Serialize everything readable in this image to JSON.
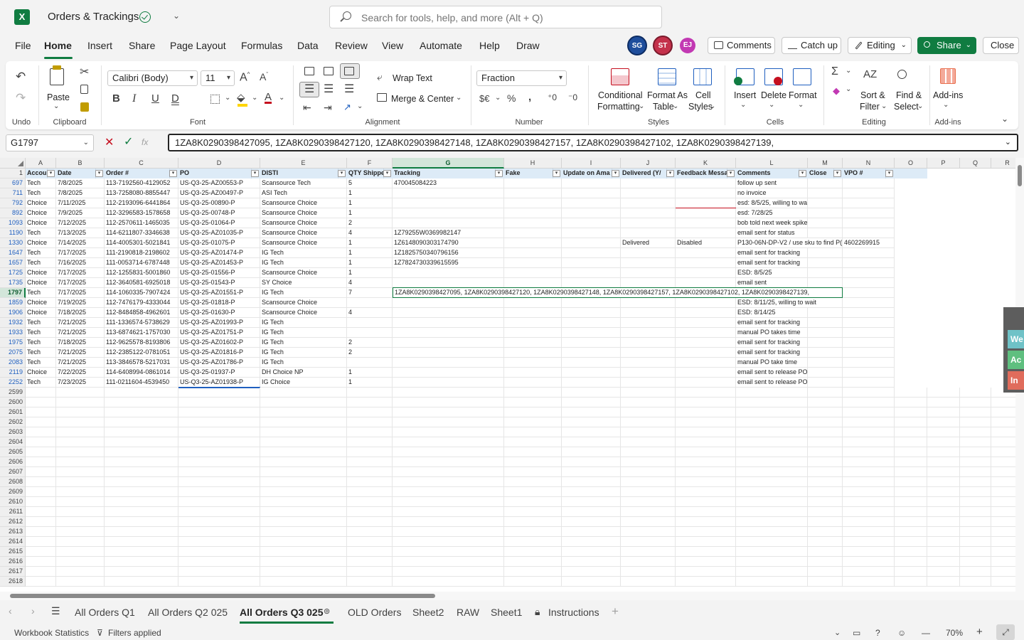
{
  "app": {
    "title": "Orders & Trackings",
    "search_placeholder": "Search for tools, help, and more (Alt + Q)"
  },
  "menu": [
    "File",
    "Home",
    "Insert",
    "Share",
    "Page Layout",
    "Formulas",
    "Data",
    "Review",
    "View",
    "Automate",
    "Help",
    "Draw"
  ],
  "header_actions": {
    "avatars": [
      {
        "initials": "SG",
        "color": "#1f4e9c"
      },
      {
        "initials": "ST",
        "color": "#c4314b"
      },
      {
        "initials": "EJ",
        "color": "#c239b3"
      }
    ],
    "comments": "Comments",
    "catch_up": "Catch up",
    "editing": "Editing",
    "share": "Share",
    "close": "Close"
  },
  "ribbon": {
    "undo_label": "Undo",
    "paste": "Paste",
    "clipboard_label": "Clipboard",
    "font_name": "Calibri (Body)",
    "font_size": "11",
    "font_label": "Font",
    "wrap_text": "Wrap Text",
    "merge_center": "Merge & Center",
    "alignment_label": "Alignment",
    "number_format": "Fraction",
    "number_label": "Number",
    "conditional_formatting_1": "Conditional",
    "conditional_formatting_2": "Formatting",
    "format_as_table_1": "Format As",
    "format_as_table_2": "Table",
    "cell_styles_1": "Cell",
    "cell_styles_2": "Styles",
    "styles_label": "Styles",
    "insert": "Insert",
    "delete": "Delete",
    "format": "Format",
    "cells_label": "Cells",
    "sort_filter_1": "Sort &",
    "sort_filter_2": "Filter",
    "find_select_1": "Find &",
    "find_select_2": "Select",
    "editing_label": "Editing",
    "addins": "Add-ins",
    "addins_label": "Add-ins"
  },
  "formula_bar": {
    "name_box": "G1797",
    "fx": "fx",
    "content": "1ZA8K0290398427095, 1ZA8K0290398427120, 1ZA8K0290398427148, 1ZA8K0290398427157, 1ZA8K0290398427102, 1ZA8K0290398427139,"
  },
  "grid": {
    "column_letters": [
      "A",
      "B",
      "C",
      "D",
      "E",
      "F",
      "G",
      "H",
      "I",
      "J",
      "K",
      "L",
      "M",
      "N",
      "O",
      "P",
      "Q",
      "R"
    ],
    "headers": [
      "Accou",
      "Date",
      "Order #",
      "PO",
      "DISTI",
      "QTY Shippe",
      "Tracking",
      "Fake",
      "Update on Ama",
      "Delivered (Y/",
      "Feedback Messa",
      "Comments",
      "Close",
      "VPO #"
    ],
    "rows": [
      {
        "n": "697",
        "cells": [
          "Tech",
          "7/8/2025",
          "113-7192560-4129052",
          "US-Q3-25-AZ00553-P",
          "Scansource Tech",
          "5",
          "470045084223",
          "",
          "",
          "",
          "",
          "follow up sent",
          "",
          ""
        ]
      },
      {
        "n": "711",
        "cells": [
          "Tech",
          "7/8/2025",
          "113-7258080-8855447",
          "US-Q3-25-AZ00497-P",
          "ASI Tech",
          "1",
          "",
          "",
          "",
          "",
          "",
          "no invoice",
          "",
          ""
        ]
      },
      {
        "n": "792",
        "cells": [
          "Choice",
          "7/11/2025",
          "112-2193096-6441864",
          "US-Q3-25-00890-P",
          "Scansource Choice",
          "1",
          "",
          "",
          "",
          "",
          "",
          "esd: 8/5/25, willing to wait",
          "",
          ""
        ]
      },
      {
        "n": "892",
        "cells": [
          "Choice",
          "7/9/2025",
          "112-3296583-1578658",
          "US-Q3-25-00748-P",
          "Scansource Choice",
          "1",
          "",
          "",
          "",
          "",
          "",
          "esd: 7/28/25",
          "",
          ""
        ]
      },
      {
        "n": "1093",
        "cells": [
          "Choice",
          "7/12/2025",
          "112-2570611-1465035",
          "US-Q3-25-01064-P",
          "Scansource Choice",
          "2",
          "",
          "",
          "",
          "",
          "",
          "bob told next week spike",
          "",
          ""
        ]
      },
      {
        "n": "1190",
        "cells": [
          "Tech",
          "7/13/2025",
          "114-6211807-3346638",
          "US-Q3-25-AZ01035-P",
          "Scansource Choice",
          "4",
          "1Z79255W0369982147",
          "",
          "",
          "",
          "",
          "email sent for status",
          "",
          ""
        ]
      },
      {
        "n": "1330",
        "cells": [
          "Choice",
          "7/14/2025",
          "114-4005301-5021841",
          "US-Q3-25-01075-P",
          "Scansource Choice",
          "1",
          "1Z6148090303174790",
          "",
          "",
          "Delivered",
          "Disabled",
          "P130-06N-DP-V2 / use sku to find P(",
          "",
          "4602269915"
        ]
      },
      {
        "n": "1647",
        "cells": [
          "Tech",
          "7/17/2025",
          "111-2190818-2198602",
          "US-Q3-25-AZ01474-P",
          "IG Tech",
          "1",
          "1Z1825750340796156",
          "",
          "",
          "",
          "",
          "email sent for tracking",
          "",
          ""
        ]
      },
      {
        "n": "1657",
        "cells": [
          "Tech",
          "7/16/2025",
          "111-0053714-6787448",
          "US-Q3-25-AZ01453-P",
          "IG Tech",
          "1",
          "1Z7824730339615595",
          "",
          "",
          "",
          "",
          "email sent for tracking",
          "",
          ""
        ]
      },
      {
        "n": "1725",
        "cells": [
          "Choice",
          "7/17/2025",
          "112-1255831-5001860",
          "US-Q3-25-01556-P",
          "Scansource Choice",
          "1",
          "",
          "",
          "",
          "",
          "",
          " ESD:  8/5/25",
          "",
          ""
        ]
      },
      {
        "n": "1735",
        "cells": [
          "Choice",
          "7/17/2025",
          "112-3640581-6925018",
          "US-Q3-25-01543-P",
          "SY Choice",
          "4",
          "",
          "",
          "",
          "",
          "",
          "email sent",
          "",
          ""
        ]
      },
      {
        "n": "1797",
        "cells": [
          "Tech",
          "7/17/2025",
          "114-1060335-7907424",
          "US-Q3-25-AZ01551-P",
          "IG Tech",
          "7",
          "1ZA8K0290398427095, 1ZA8K0290398427120, 1ZA8K0290398427148, 1ZA8K0290398427157, 1ZA8K0290398427102, 1ZA8K0290398427139,",
          "",
          "",
          "",
          "",
          "",
          "",
          ""
        ]
      },
      {
        "n": "1859",
        "cells": [
          "Choice",
          "7/19/2025",
          "112-7476179-4333044",
          "US-Q3-25-01818-P",
          "Scansource Choice",
          "",
          "",
          "",
          "",
          "",
          "",
          "ESD: 8/11/25, willing to wait",
          "",
          ""
        ]
      },
      {
        "n": "1906",
        "cells": [
          "Choice",
          "7/18/2025",
          "112-8484858-4962601",
          "US-Q3-25-01630-P",
          "Scansource Choice",
          "4",
          "",
          "",
          "",
          "",
          "",
          "ESD: 8/14/25",
          "",
          ""
        ]
      },
      {
        "n": "1932",
        "cells": [
          "Tech",
          "7/21/2025",
          "111-1336574-5738629",
          "US-Q3-25-AZ01993-P",
          "IG Tech",
          "",
          "",
          "",
          "",
          "",
          "",
          "email sent for tracking",
          "",
          ""
        ]
      },
      {
        "n": "1933",
        "cells": [
          "Tech",
          "7/21/2025",
          "113-6874621-1757030",
          "US-Q3-25-AZ01751-P",
          "IG Tech",
          "",
          "",
          "",
          "",
          "",
          "",
          "manual PO takes time",
          "",
          ""
        ]
      },
      {
        "n": "1975",
        "cells": [
          "Tech",
          "7/18/2025",
          "112-9625578-8193806",
          "US-Q3-25-AZ01602-P",
          "IG Tech",
          "2",
          "",
          "",
          "",
          "",
          "",
          "email sent for tracking",
          "",
          ""
        ]
      },
      {
        "n": "2075",
        "cells": [
          "Tech",
          "7/21/2025",
          "112-2385122-0781051",
          "US-Q3-25-AZ01816-P",
          "IG Tech",
          "2",
          "",
          "",
          "",
          "",
          "",
          "email sent for tracking",
          "",
          ""
        ]
      },
      {
        "n": "2083",
        "cells": [
          "Tech",
          "7/21/2025",
          "113-3846578-5217031",
          "US-Q3-25-AZ01786-P",
          "IG Tech",
          "",
          "",
          "",
          "",
          "",
          "",
          "manual PO take time",
          "",
          ""
        ]
      },
      {
        "n": "2119",
        "cells": [
          "Choice",
          "7/22/2025",
          "114-6408994-0861014",
          "US-Q3-25-01937-P",
          "DH Choice NP",
          "1",
          "",
          "",
          "",
          "",
          "",
          "email sent to release PO",
          "",
          ""
        ]
      },
      {
        "n": "2252",
        "cells": [
          "Tech",
          "7/23/2025",
          "111-0211604-4539450",
          "US-Q3-25-AZ01938-P",
          "IG Choice",
          "1",
          "",
          "",
          "",
          "",
          "",
          "email sent to release PO",
          "",
          ""
        ]
      }
    ],
    "empty_rows": [
      "2599",
      "2600",
      "2601",
      "2602",
      "2603",
      "2604",
      "2605",
      "2606",
      "2607",
      "2608",
      "2609",
      "2610",
      "2611",
      "2612",
      "2613",
      "2614",
      "2615",
      "2616",
      "2617",
      "2618"
    ],
    "header_row_number": "1"
  },
  "side_panel_peek": [
    "We",
    "Ac",
    "In"
  ],
  "sheet_tabs": [
    "All Orders Q1",
    "All Orders Q2 025",
    "All Orders Q3 025",
    "OLD Orders",
    "Sheet2",
    "RAW",
    "Sheet1",
    "Instructions"
  ],
  "status": {
    "workbook_stats": "Workbook Statistics",
    "filters": "Filters applied",
    "zoom": "70%"
  },
  "colors": {
    "accent": "#107c41",
    "header_fill": "#ddebf7"
  }
}
